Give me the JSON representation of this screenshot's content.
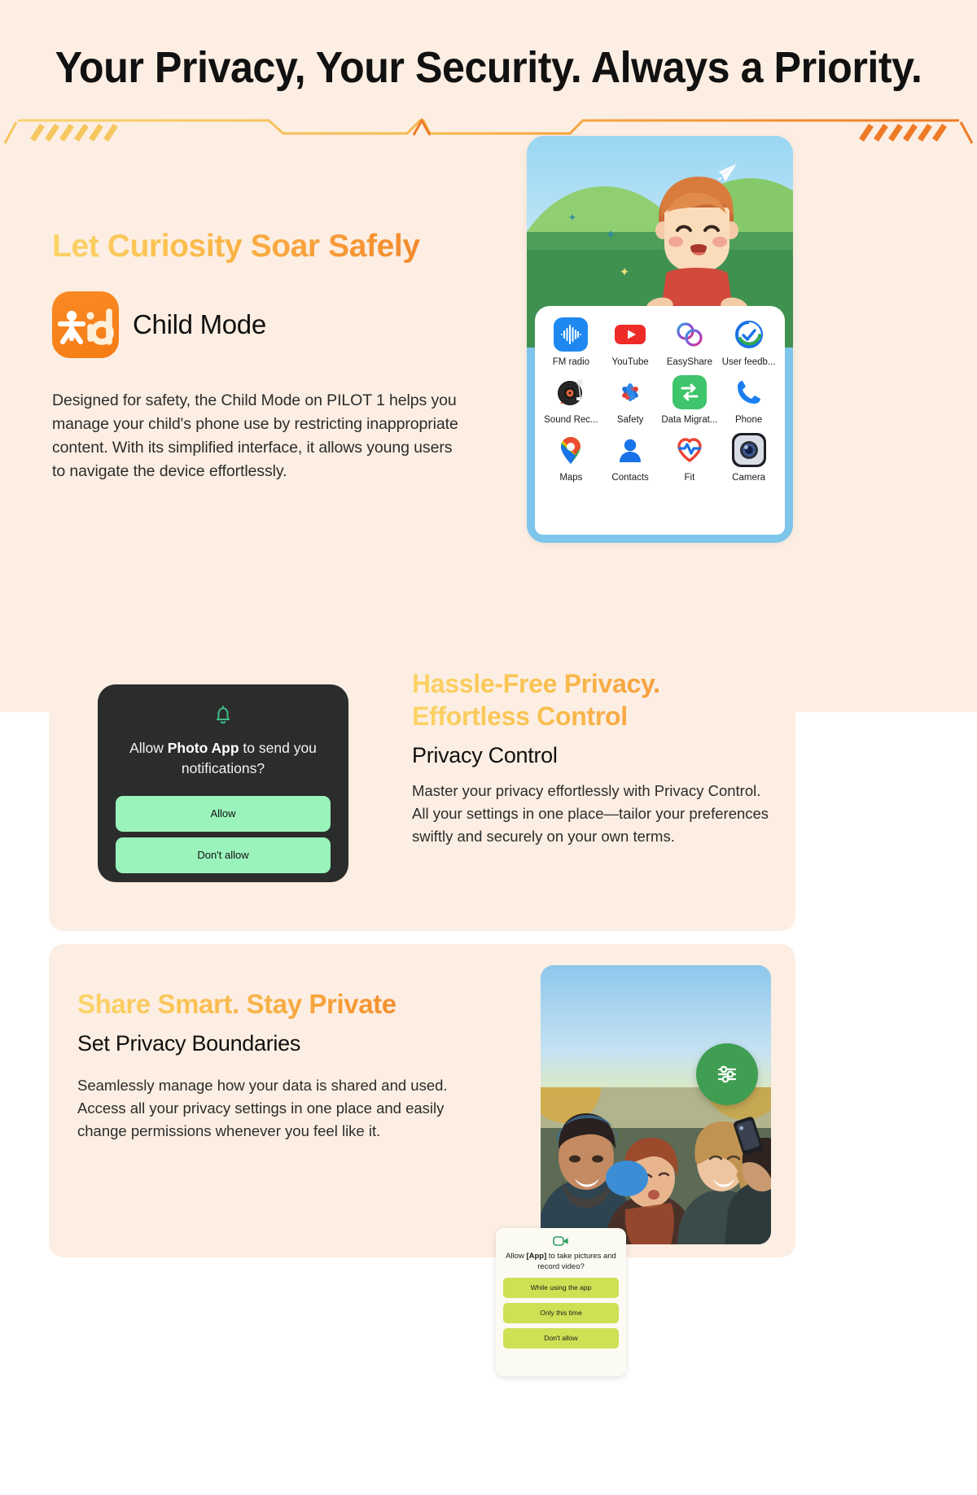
{
  "hero": {
    "title": "Your Privacy, Your Security. Always a Priority."
  },
  "child_mode": {
    "headline": "Let Curiosity Soar Safely",
    "logo_text": "id",
    "brand_label": "Child Mode",
    "body": "Designed for safety, the Child Mode on PILOT 1 helps you manage your child's phone use by restricting inappropriate content. With its simplified interface, it allows young users to navigate the device effortlessly.",
    "apps": [
      {
        "label": "FM radio",
        "icon": "fm-radio-icon"
      },
      {
        "label": "YouTube",
        "icon": "youtube-icon"
      },
      {
        "label": "EasyShare",
        "icon": "easyshare-icon"
      },
      {
        "label": "User feedb...",
        "icon": "user-feedback-icon"
      },
      {
        "label": "Sound Rec...",
        "icon": "sound-recorder-icon"
      },
      {
        "label": "Safety",
        "icon": "safety-icon"
      },
      {
        "label": "Data Migrat...",
        "icon": "data-migration-icon"
      },
      {
        "label": "Phone",
        "icon": "phone-icon"
      },
      {
        "label": "Maps",
        "icon": "maps-icon"
      },
      {
        "label": "Contacts",
        "icon": "contacts-icon"
      },
      {
        "label": "Fit",
        "icon": "fit-icon"
      },
      {
        "label": "Camera",
        "icon": "camera-icon"
      }
    ]
  },
  "privacy_control": {
    "headline_line1": "Hassle-Free Privacy.",
    "headline_line2": "Effortless Control",
    "subtitle": "Privacy Control",
    "body": "Master your privacy effortlessly with Privacy Control. All your settings in one place—tailor your preferences swiftly and securely on your own terms.",
    "notification": {
      "icon": "bell-icon",
      "prompt_prefix": "Allow ",
      "prompt_app": "Photo App",
      "prompt_suffix": " to send you notifications?",
      "allow_label": "Allow",
      "deny_label": "Don't allow"
    }
  },
  "share_smart": {
    "headline": "Share Smart. Stay Private",
    "subtitle": "Set Privacy Boundaries",
    "body": "Seamlessly manage how your data is shared and used. Access all your privacy settings in one place and easily change permissions whenever you feel like it.",
    "fab_icon": "sliders-icon",
    "permission": {
      "icon": "video-camera-icon",
      "prompt_prefix": "Allow ",
      "prompt_app": "[App]",
      "prompt_suffix": " to take pictures and record video?",
      "options": [
        "While using the app",
        "Only this time",
        "Don't allow"
      ]
    }
  },
  "colors": {
    "page_bg": "#fceee2",
    "accent_yellow": "#fbd366",
    "accent_orange": "#ef7a26",
    "brand_orange": "#f57c15",
    "notif_bg": "#2b2d2c",
    "notif_button": "#9af3bb",
    "perm_button": "#cfe055",
    "fab_green": "#3f9e52"
  }
}
